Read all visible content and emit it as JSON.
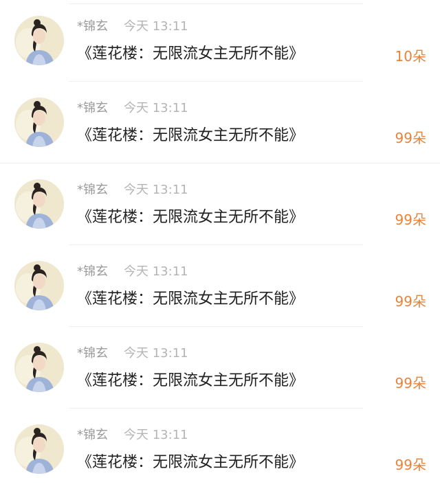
{
  "comments": [
    {
      "username": "*锦玄",
      "time": "今天 13:11",
      "message": "《莲花楼：无限流女主无所不能》",
      "count": "10朵",
      "avatar_icon": "user-avatar-icon"
    },
    {
      "username": "*锦玄",
      "time": "今天 13:11",
      "message": "《莲花楼：无限流女主无所不能》",
      "count": "99朵",
      "avatar_icon": "user-avatar-icon"
    },
    {
      "username": "*锦玄",
      "time": "今天 13:11",
      "message": "《莲花楼：无限流女主无所不能》",
      "count": "99朵",
      "avatar_icon": "user-avatar-icon"
    },
    {
      "username": "*锦玄",
      "time": "今天 13:11",
      "message": "《莲花楼：无限流女主无所不能》",
      "count": "99朵",
      "avatar_icon": "user-avatar-icon"
    },
    {
      "username": "*锦玄",
      "time": "今天 13:11",
      "message": "《莲花楼：无限流女主无所不能》",
      "count": "99朵",
      "avatar_icon": "user-avatar-icon"
    },
    {
      "username": "*锦玄",
      "time": "今天 13:11",
      "message": "《莲花楼：无限流女主无所不能》",
      "count": "99朵",
      "avatar_icon": "user-avatar-icon"
    }
  ],
  "colors": {
    "count": "#e8833a",
    "username": "#9a9a9a",
    "time": "#b4b4b4",
    "message": "#1f1f1f"
  }
}
